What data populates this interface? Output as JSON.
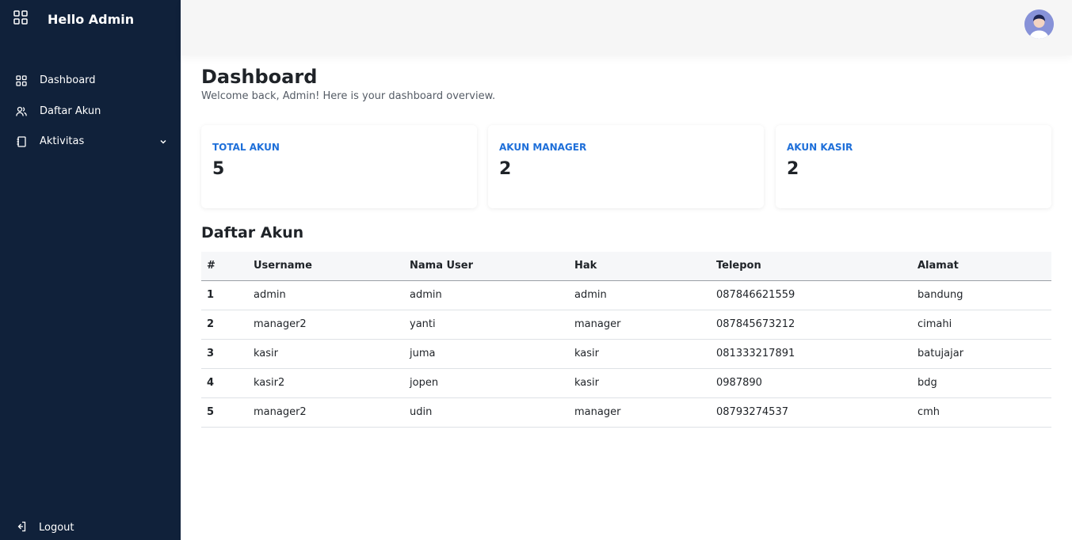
{
  "sidebar": {
    "brand_title": "Hello Admin",
    "brand_icon": "grid-icon",
    "items": [
      {
        "label": "Dashboard",
        "icon": "grid-icon"
      },
      {
        "label": "Daftar Akun",
        "icon": "users-icon"
      },
      {
        "label": "Aktivitas",
        "icon": "notebook-icon",
        "has_submenu": true
      }
    ],
    "logout_label": "Logout",
    "logout_icon": "logout-icon"
  },
  "header": {
    "avatar_icon": "user-avatar-icon"
  },
  "main": {
    "title": "Dashboard",
    "subtitle": "Welcome back, Admin! Here is your dashboard overview.",
    "stats": [
      {
        "label": "TOTAL AKUN",
        "value": "5"
      },
      {
        "label": "AKUN MANAGER",
        "value": "2"
      },
      {
        "label": "AKUN KASIR",
        "value": "2"
      }
    ],
    "table_title": "Daftar Akun",
    "table": {
      "columns": [
        "#",
        "Username",
        "Nama User",
        "Hak",
        "Telepon",
        "Alamat"
      ],
      "rows": [
        [
          "1",
          "admin",
          "admin",
          "admin",
          "087846621559",
          "bandung"
        ],
        [
          "2",
          "manager2",
          "yanti",
          "manager",
          "087845673212",
          "cimahi"
        ],
        [
          "3",
          "kasir",
          "juma",
          "kasir",
          "081333217891",
          "batujajar"
        ],
        [
          "4",
          "kasir2",
          "jopen",
          "kasir",
          "0987890",
          "bdg"
        ],
        [
          "5",
          "manager2",
          "udin",
          "manager",
          "08793274537",
          "cmh"
        ]
      ]
    }
  },
  "colors": {
    "sidebar_bg": "#10213a",
    "accent": "#1e6fd9",
    "topbar_bg": "#f6f6f6"
  }
}
